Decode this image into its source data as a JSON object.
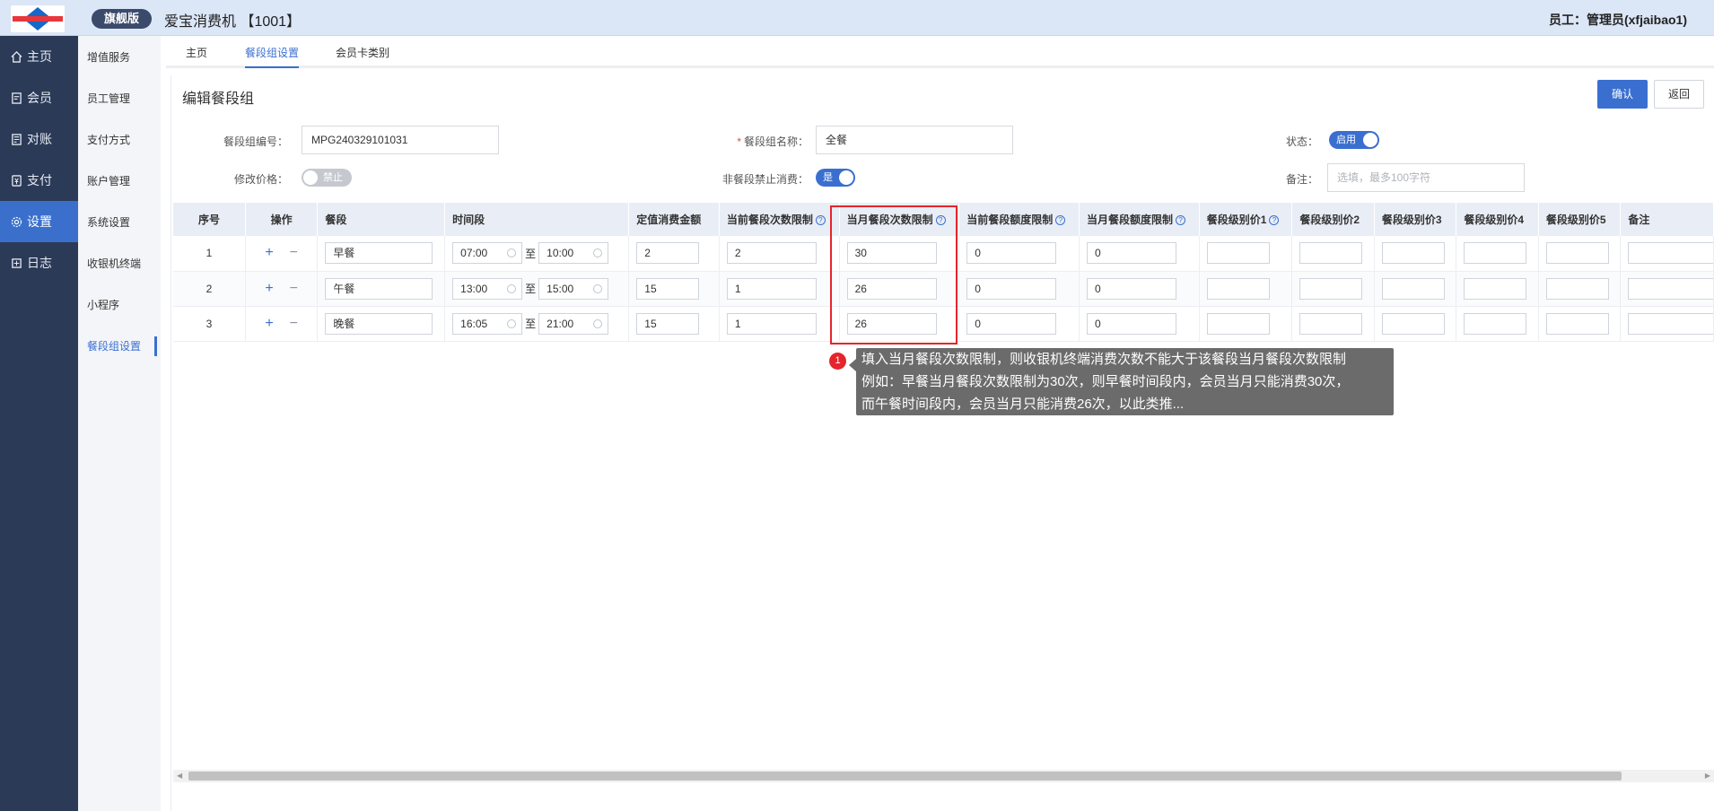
{
  "header": {
    "edition": "旗舰版",
    "app_title": "爱宝消费机 【1001】",
    "staff": "员工：管理员(xfjaibao1)"
  },
  "sidebar": {
    "items": [
      {
        "label": "主页",
        "icon": "home-icon"
      },
      {
        "label": "会员",
        "icon": "member-icon"
      },
      {
        "label": "对账",
        "icon": "reconcile-icon"
      },
      {
        "label": "支付",
        "icon": "payment-icon"
      },
      {
        "label": "设置",
        "icon": "gear-icon",
        "active": true
      },
      {
        "label": "日志",
        "icon": "log-icon"
      }
    ]
  },
  "subnav": {
    "items": [
      "增值服务",
      "员工管理",
      "支付方式",
      "账户管理",
      "系统设置",
      "收银机终端",
      "小程序",
      "餐段组设置"
    ],
    "active": "餐段组设置"
  },
  "tabs": [
    "主页",
    "餐段组设置",
    "会员卡类别"
  ],
  "form": {
    "title": "编辑餐段组",
    "confirm": "确认",
    "back": "返回",
    "code_label": "餐段组编号：",
    "code_value": "MPG240329101031",
    "name_label": "餐段组名称：",
    "name_value": "全餐",
    "status_label": "状态：",
    "status_value": "启用",
    "price_label": "修改价格：",
    "price_value": "禁止",
    "nonmeal_label": "非餐段禁止消费：",
    "nonmeal_value": "是",
    "remark_label": "备注：",
    "remark_placeholder": "选填，最多100字符"
  },
  "table": {
    "headers": [
      "序号",
      "操作",
      "餐段",
      "时间段",
      "定值消费金额",
      "当前餐段次数限制",
      "当月餐段次数限制",
      "当前餐段额度限制",
      "当月餐段额度限制",
      "餐段级别价1",
      "餐段级别价2",
      "餐段级别价3",
      "餐段级别价4",
      "餐段级别价5",
      "备注"
    ],
    "time_sep": "至",
    "rows": [
      {
        "no": "1",
        "meal": "早餐",
        "start": "07:00",
        "end": "10:00",
        "fixed": "2",
        "cur_count": "2",
        "month_count": "30",
        "cur_amount": "0",
        "month_amount": "0"
      },
      {
        "no": "2",
        "meal": "午餐",
        "start": "13:00",
        "end": "15:00",
        "fixed": "15",
        "cur_count": "1",
        "month_count": "26",
        "cur_amount": "0",
        "month_amount": "0"
      },
      {
        "no": "3",
        "meal": "晚餐",
        "start": "16:05",
        "end": "21:00",
        "fixed": "15",
        "cur_count": "1",
        "month_count": "26",
        "cur_amount": "0",
        "month_amount": "0"
      }
    ]
  },
  "annotation": {
    "badge": "1",
    "lines": [
      "填入当月餐段次数限制，则收银机终端消费次数不能大于该餐段当月餐段次数限制",
      "例如：早餐当月餐段次数限制为30次，则早餐时间段内，会员当月只能消费30次，",
      "而午餐时间段内，会员当月只能消费26次，以此类推..."
    ]
  }
}
